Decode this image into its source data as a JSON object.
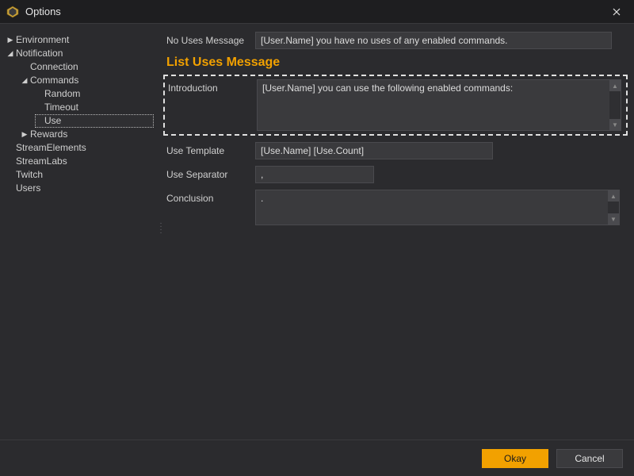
{
  "window": {
    "title": "Options"
  },
  "sidebar": {
    "items": [
      {
        "label": "Environment",
        "expanded": false,
        "hasChildren": true
      },
      {
        "label": "Notification",
        "expanded": true,
        "hasChildren": true,
        "children": [
          {
            "label": "Connection",
            "hasChildren": false
          },
          {
            "label": "Commands",
            "expanded": true,
            "hasChildren": true,
            "children": [
              {
                "label": "Random",
                "hasChildren": false
              },
              {
                "label": "Timeout",
                "hasChildren": false
              },
              {
                "label": "Use",
                "hasChildren": false,
                "selected": true
              }
            ]
          },
          {
            "label": "Rewards",
            "expanded": false,
            "hasChildren": true
          }
        ]
      },
      {
        "label": "StreamElements",
        "hasChildren": false
      },
      {
        "label": "StreamLabs",
        "hasChildren": false
      },
      {
        "label": "Twitch",
        "hasChildren": false
      },
      {
        "label": "Users",
        "hasChildren": false
      }
    ]
  },
  "form": {
    "noUses": {
      "label": "No Uses Message",
      "value": "[User.Name] you have no uses of any enabled commands."
    },
    "sectionTitle": "List Uses Message",
    "introduction": {
      "label": "Introduction",
      "value": "[User.Name] you can use the following enabled commands:"
    },
    "useTemplate": {
      "label": "Use Template",
      "value": "[Use.Name] [Use.Count]"
    },
    "useSeparator": {
      "label": "Use Separator",
      "value": ","
    },
    "conclusion": {
      "label": "Conclusion",
      "value": "."
    }
  },
  "footer": {
    "okay": "Okay",
    "cancel": "Cancel"
  }
}
